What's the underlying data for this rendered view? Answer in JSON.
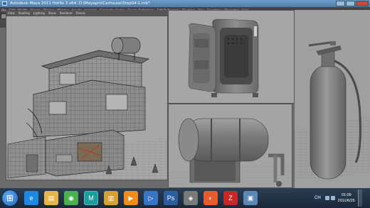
{
  "window": {
    "title": "Autodesk Maya 2011 Hotfix 3 x64: D:\\Mayapro\\Carhouse\\Step04-1.mb*",
    "menu": [
      "File",
      "Edit",
      "Modify",
      "Create",
      "Display",
      "Window",
      "Assets",
      "Animate",
      "Geometry Cache",
      "Create Deformers",
      "Edit Deformers",
      "Skeleton",
      "Skin",
      "Constrain",
      "Character",
      "Help"
    ]
  },
  "viewport": {
    "menu": [
      "View",
      "Shading",
      "Lighting",
      "Show",
      "Renderer",
      "Panels"
    ]
  },
  "taskbar": {
    "start_icon": "windows-start-icon",
    "icons": [
      {
        "name": "ie-icon",
        "glyph": "e",
        "color": "#1e88e5"
      },
      {
        "name": "explorer-icon",
        "glyph": "▤",
        "color": "#e8b54a"
      },
      {
        "name": "chrome-icon",
        "glyph": "◉",
        "color": "#4caf50"
      },
      {
        "name": "maya-icon",
        "glyph": "M",
        "color": "#1b9e9e"
      },
      {
        "name": "folder-icon",
        "glyph": "▥",
        "color": "#d4a236"
      },
      {
        "name": "media-icon",
        "glyph": "▶",
        "color": "#f08c1c"
      },
      {
        "name": "player-icon",
        "glyph": "▷",
        "color": "#3a74c5"
      },
      {
        "name": "ps-icon",
        "glyph": "Ps",
        "color": "#2c5fa0"
      },
      {
        "name": "tool-icon",
        "glyph": "◈",
        "color": "#7a7a7a"
      },
      {
        "name": "browser-icon",
        "glyph": "◐",
        "color": "#e65a2e"
      },
      {
        "name": "filezilla-icon",
        "glyph": "Z",
        "color": "#c62828"
      },
      {
        "name": "window-icon",
        "glyph": "▣",
        "color": "#5b87b8"
      }
    ],
    "lang": "CH",
    "time": "01:09",
    "date": "2011/6/25"
  }
}
